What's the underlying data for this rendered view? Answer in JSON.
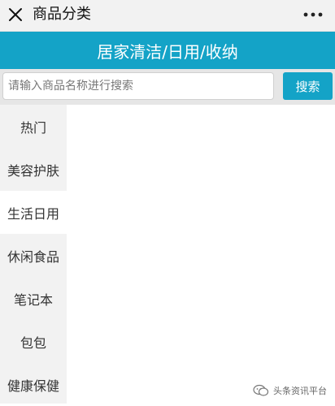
{
  "topbar": {
    "title": "商品分类",
    "close_icon": "close-icon",
    "more_icon": "more-dots-icon"
  },
  "header": {
    "title": "居家清洁/日用/收纳"
  },
  "search": {
    "placeholder": "请输入商品名称进行搜索",
    "value": "",
    "button_label": "搜索"
  },
  "sidebar": {
    "active_index": 2,
    "items": [
      {
        "label": "热门"
      },
      {
        "label": "美容护肤"
      },
      {
        "label": "生活日用"
      },
      {
        "label": "休闲食品"
      },
      {
        "label": "笔记本"
      },
      {
        "label": "包包"
      },
      {
        "label": "健康保健"
      }
    ]
  },
  "watermark": {
    "text": "头条资讯平台",
    "icon": "wechat-icon"
  },
  "colors": {
    "accent": "#14a3c7",
    "sidebar_bg": "#f2f2f2",
    "topbar_bg": "#f2f2f2"
  }
}
